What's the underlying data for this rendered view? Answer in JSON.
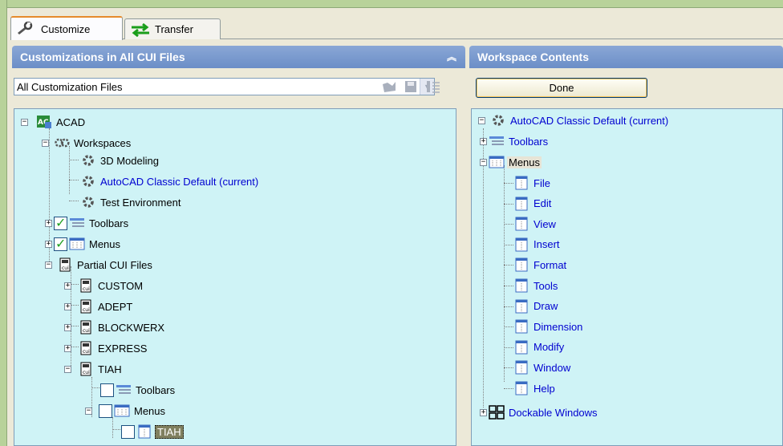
{
  "tabs": {
    "customize": "Customize",
    "transfer": "Transfer"
  },
  "left_panel": {
    "title": "Customizations in All CUI Files",
    "filter_value": "All Customization Files",
    "tree": {
      "acad": "ACAD",
      "workspaces": "Workspaces",
      "ws_3d": "3D Modeling",
      "ws_classic": "AutoCAD Classic Default (current)",
      "ws_test": "Test Environment",
      "toolbars": "Toolbars",
      "menus": "Menus",
      "partial": "Partial CUI Files",
      "custom": "CUSTOM",
      "adept": "ADEPT",
      "blockwerx": "BLOCKWERX",
      "express": "EXPRESS",
      "tiah": "TIAH",
      "tiah_toolbars": "Toolbars",
      "tiah_menus": "Menus",
      "tiah_menu_item": "TIAH"
    }
  },
  "right_panel": {
    "title": "Workspace Contents",
    "done_label": "Done",
    "tree": {
      "root": "AutoCAD Classic Default (current)",
      "toolbars": "Toolbars",
      "menus": "Menus",
      "menu_items": [
        "File",
        "Edit",
        "View",
        "Insert",
        "Format",
        "Tools",
        "Draw",
        "Dimension",
        "Modify",
        "Window",
        "Help"
      ],
      "dockable": "Dockable Windows"
    }
  },
  "colors": {
    "tree_bg": "#cff3f6",
    "header": "#7897cc",
    "link_blue": "#0000d0"
  }
}
